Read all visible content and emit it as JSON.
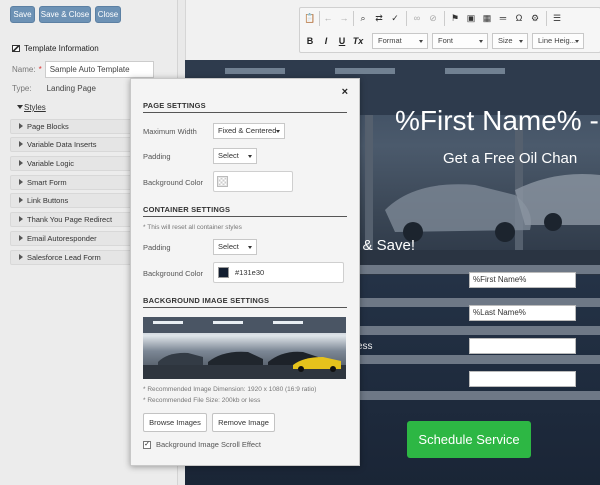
{
  "sidebar": {
    "buttons": {
      "save": "Save",
      "save_close": "Save & Close",
      "close": "Close"
    },
    "template_info": "Template Information",
    "name_label": "Name:",
    "name_required": "*",
    "name_value": "Sample Auto Template",
    "type_label": "Type:",
    "type_value": "Landing Page",
    "styles_label": "Styles",
    "items": [
      {
        "label": "Page Blocks"
      },
      {
        "label": "Variable Data Inserts"
      },
      {
        "label": "Variable Logic"
      },
      {
        "label": "Smart Form"
      },
      {
        "label": "Link Buttons"
      },
      {
        "label": "Thank You Page Redirect"
      },
      {
        "label": "Email Autoresponder"
      },
      {
        "label": "Salesforce Lead Form"
      }
    ]
  },
  "toolbar": {
    "bold": "B",
    "italic": "I",
    "underline": "U",
    "clear_format": "Tx",
    "format_combo": "Format",
    "font_combo": "Font",
    "size_combo": "Size",
    "line_height_combo": "Line Heig..."
  },
  "canvas": {
    "headline": "%First Name% -",
    "subheadline": "Get a Free Oil Chan",
    "form_title": "e & Save!",
    "field_label_fragment": "ess",
    "fields": [
      "%First Name%",
      "%Last Name%",
      "",
      ""
    ],
    "button": "Schedule Service",
    "background_color": "#131e30"
  },
  "modal": {
    "close": "×",
    "page_settings": {
      "title": "PAGE SETTINGS",
      "max_width_label": "Maximum Width",
      "max_width_value": "Fixed & Centered",
      "padding_label": "Padding",
      "padding_value": "Select",
      "bg_color_label": "Background Color"
    },
    "container_settings": {
      "title": "CONTAINER SETTINGS",
      "note": "* This will reset all container styles",
      "padding_label": "Padding",
      "padding_value": "Select",
      "bg_color_label": "Background Color",
      "bg_color_value": "#131e30"
    },
    "bg_image_settings": {
      "title": "BACKGROUND IMAGE SETTINGS",
      "note_dimension": "* Recommended Image Dimension: 1920 x 1080 (16:9 ratio)",
      "note_size": "* Recommended File Size: 200kb or less",
      "browse": "Browse Images",
      "remove": "Remove Image",
      "scroll_effect": "Background Image Scroll Effect",
      "scroll_effect_checked": true
    }
  }
}
